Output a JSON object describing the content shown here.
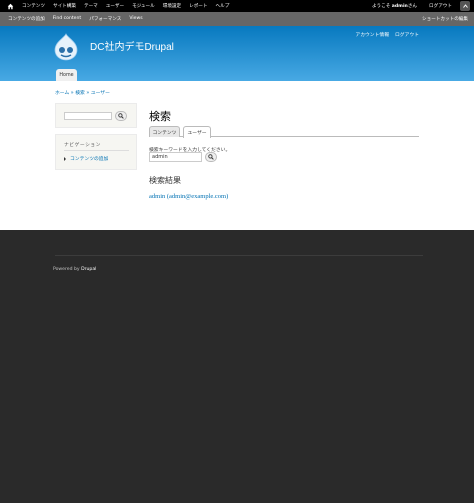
{
  "toolbar": {
    "menu": [
      "コンテンツ",
      "サイト構築",
      "テーマ",
      "ユーザー",
      "モジュール",
      "環境設定",
      "レポート",
      "ヘルプ"
    ],
    "welcome_prefix": "ようこそ ",
    "welcome_user": "admin",
    "welcome_suffix": "さん",
    "logout": "ログアウト"
  },
  "shortcuts": {
    "items": [
      "コンテンツの追加",
      "Find content",
      "パフォーマンス",
      "Views"
    ],
    "edit": "ショートカットの編集"
  },
  "header": {
    "site_name": "DC社内デモDrupal",
    "secondary_links": [
      "アカウント情報",
      "ログアウト"
    ],
    "main_tab": "Home"
  },
  "breadcrumb": "ホーム » 検索 » ユーザー",
  "sidebar": {
    "nav_title": "ナビゲーション",
    "nav_item": "コンテンツの追加"
  },
  "main": {
    "title": "検索",
    "tabs": [
      "コンテンツ",
      "ユーザー"
    ],
    "keyword_label": "検索キーワードを入力してください。",
    "keyword_value": "admin",
    "results_title": "検索結果",
    "result_link": "admin (admin@example.com)"
  },
  "footer": {
    "powered_prefix": "Powered by ",
    "powered_link": "Drupal"
  },
  "colors": {
    "header_top": "#0779bf",
    "header_bottom": "#48a9e4",
    "link": "#0071b3",
    "footer_bg": "#2a2a2a"
  }
}
